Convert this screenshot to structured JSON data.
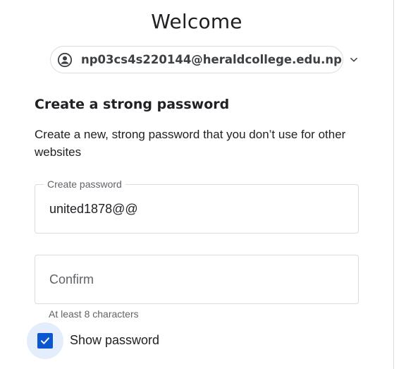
{
  "page": {
    "title": "Welcome"
  },
  "account": {
    "email": "np03cs4s220144@heraldcollege.edu.np",
    "avatar_icon": "account-circle-icon",
    "dropdown_icon": "chevron-down-icon"
  },
  "form": {
    "heading": "Create a strong password",
    "description": "Create a new, strong password that you don’t use for other websites",
    "password_label": "Create password",
    "password_value": "united1878@@",
    "confirm_placeholder": "Confirm",
    "confirm_value": "",
    "hint": "At least 8 characters",
    "show_password_label": "Show password",
    "show_password_checked": true
  },
  "colors": {
    "accent": "#0b57d0",
    "checkbox_halo": "#e3edfb",
    "border": "#dadce0",
    "text": "#202124",
    "muted": "#5f6368"
  }
}
